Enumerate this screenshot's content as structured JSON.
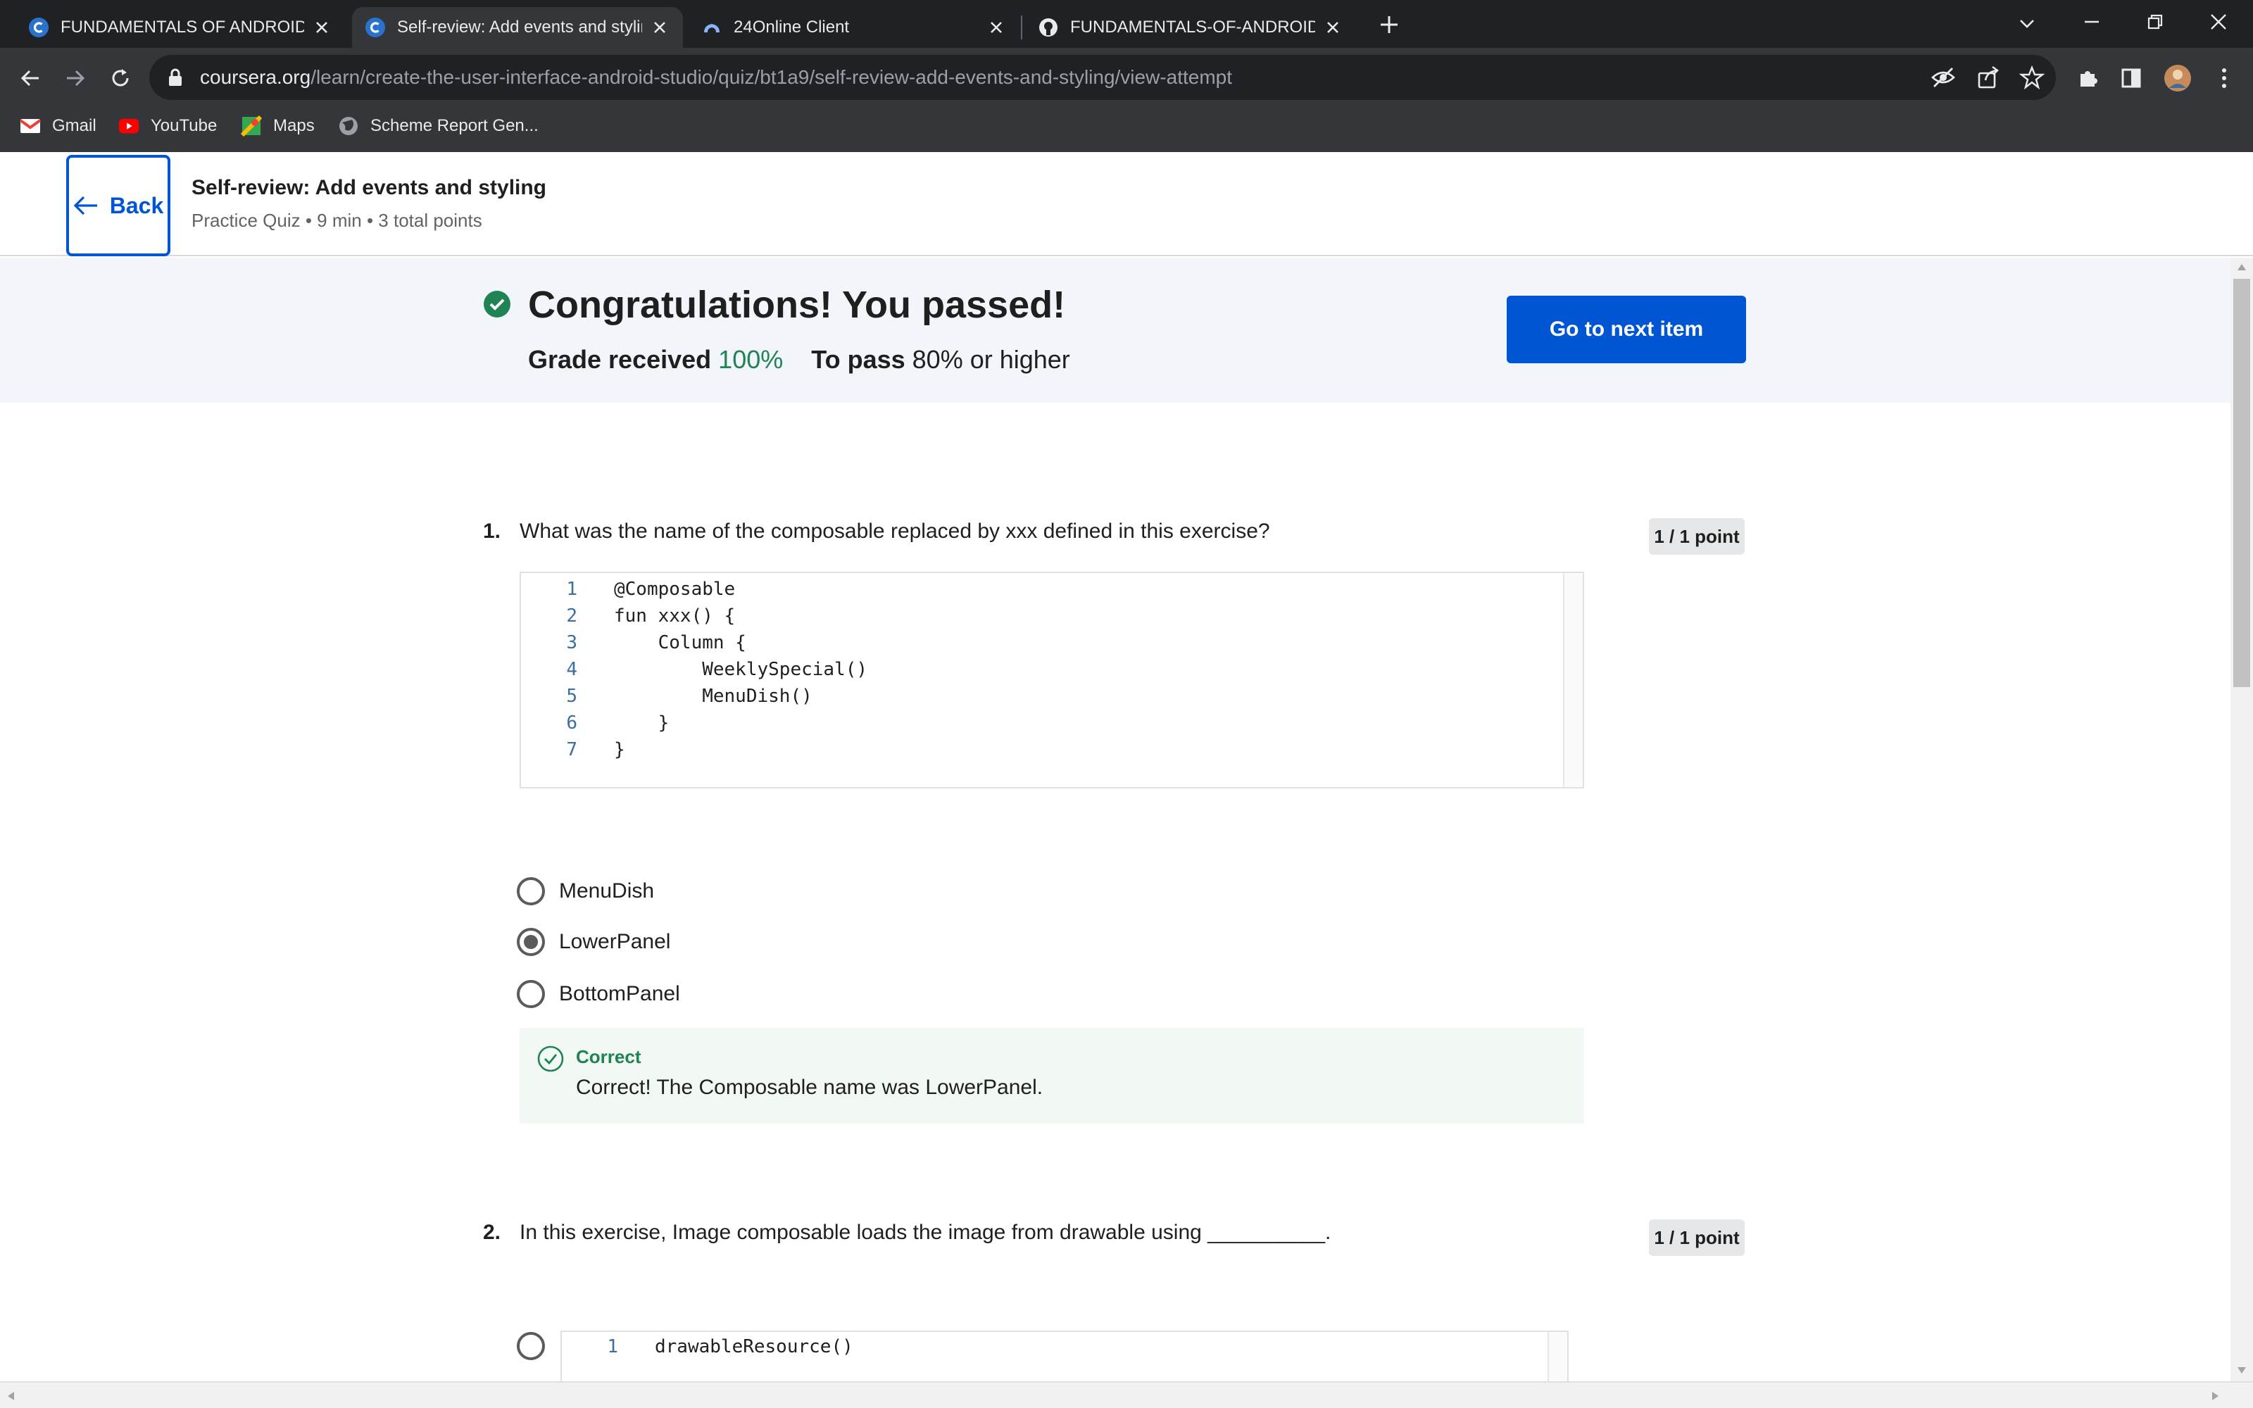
{
  "browser": {
    "tabs": [
      {
        "title": "FUNDAMENTALS OF ANDROID ::",
        "favicon": "coursera-icon",
        "active": false
      },
      {
        "title": "Self-review: Add events and styling",
        "favicon": "coursera-icon",
        "active": true
      },
      {
        "title": "24Online Client",
        "favicon": "cloud-icon",
        "active": false
      },
      {
        "title": "FUNDAMENTALS-OF-ANDROID-C",
        "favicon": "github-icon",
        "active": false
      }
    ],
    "url_host": "coursera.org",
    "url_path": "/learn/create-the-user-interface-android-studio/quiz/bt1a9/self-review-add-events-and-styling/view-attempt",
    "bookmarks": [
      {
        "label": "Gmail",
        "icon": "gmail-icon"
      },
      {
        "label": "YouTube",
        "icon": "youtube-icon"
      },
      {
        "label": "Maps",
        "icon": "maps-icon"
      },
      {
        "label": "Scheme Report Gen...",
        "icon": "globe-icon"
      }
    ]
  },
  "header": {
    "back_label": "Back",
    "title": "Self-review: Add events and styling",
    "meta": "Practice Quiz • 9 min • 3 total points"
  },
  "result": {
    "title": "Congratulations! You passed!",
    "grade_label": "Grade received",
    "grade_value": "100%",
    "pass_label": "To pass",
    "pass_value": "80% or higher",
    "next_button": "Go to next item"
  },
  "questions": [
    {
      "number": "1.",
      "text": "What was the name of the composable replaced by xxx defined in this exercise?",
      "points": "1 / 1 point",
      "code": [
        {
          "ln": "1",
          "src": "@Composable"
        },
        {
          "ln": "2",
          "src": "fun xxx() {"
        },
        {
          "ln": "3",
          "src": "    Column {"
        },
        {
          "ln": "4",
          "src": "        WeeklySpecial()"
        },
        {
          "ln": "5",
          "src": "        MenuDish()"
        },
        {
          "ln": "6",
          "src": "    }"
        },
        {
          "ln": "7",
          "src": "}"
        }
      ],
      "options": [
        {
          "label": "MenuDish",
          "selected": false
        },
        {
          "label": "LowerPanel",
          "selected": true
        },
        {
          "label": "BottomPanel",
          "selected": false
        }
      ],
      "feedback": {
        "label": "Correct",
        "text": "Correct! The Composable name was LowerPanel."
      }
    },
    {
      "number": "2.",
      "text": "In this exercise, Image composable loads the image from drawable using __________.",
      "points": "1 / 1 point",
      "options_code": [
        {
          "ln": "1",
          "src": "drawableResource()",
          "selected": false
        }
      ]
    }
  ],
  "colors": {
    "brand_blue": "#0056d2",
    "success_green": "#1f8354",
    "banner_bg": "#f2f5fa",
    "feedback_bg": "#f2f8f3"
  }
}
